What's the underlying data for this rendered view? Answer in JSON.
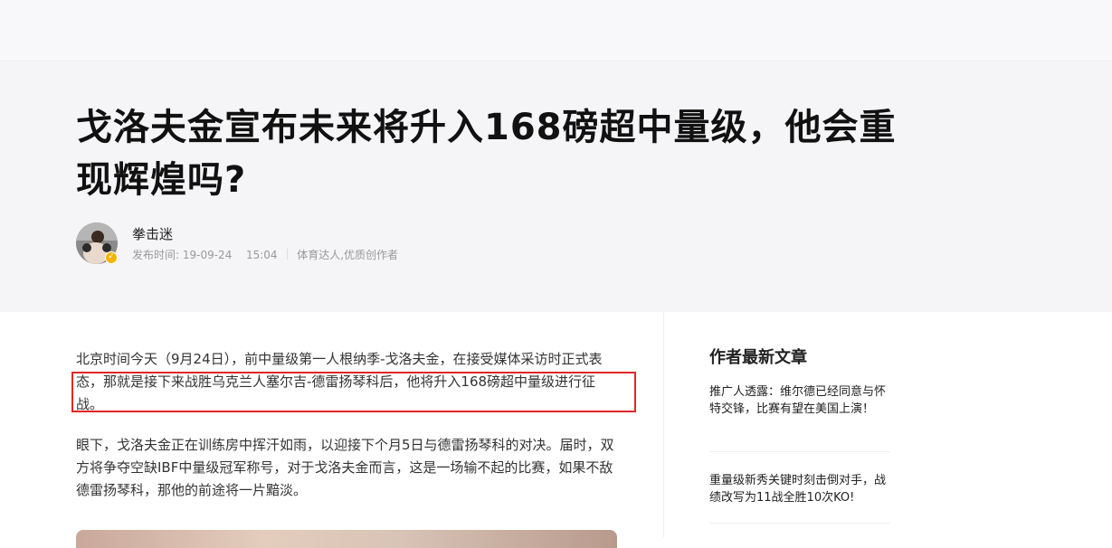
{
  "article": {
    "title": "戈洛夫金宣布未来将升入168磅超中量级，他会重现辉煌吗?",
    "author": {
      "name": "拳击迷",
      "publish_label": "发布时间: 19-09-24",
      "publish_time": "15:04",
      "tagline": "体育达人,优质创作者",
      "verified_badge_icon": "verified-check-icon"
    },
    "paragraphs": [
      "北京时间今天（9月24日），前中量级第一人根纳季-戈洛夫金，在接受媒体采访时正式表态，那就是接下来战胜乌克兰人塞尔吉-德雷扬琴科后，他将升入168磅超中量级进行征战。",
      "眼下，戈洛夫金正在训练房中挥汗如雨，以迎接下个月5日与德雷扬琴科的对决。届时，双方将争夺空缺IBF中量级冠军称号，对于戈洛夫金而言，这是一场输不起的比赛，如果不敌德雷扬琴科，那他的前途将一片黯淡。"
    ]
  },
  "sidebar": {
    "title": "作者最新文章",
    "items": [
      {
        "title": "推广人透露：维尔德已经同意与怀特交锋，比赛有望在美国上演！"
      },
      {
        "title": "重量级新秀关键时刻击倒对手，战绩改写为11战全胜10次KO!"
      }
    ]
  },
  "colors": {
    "highlight_border": "#e0262a",
    "header_bg": "#f5f5f7",
    "badge": "#f5b400"
  }
}
